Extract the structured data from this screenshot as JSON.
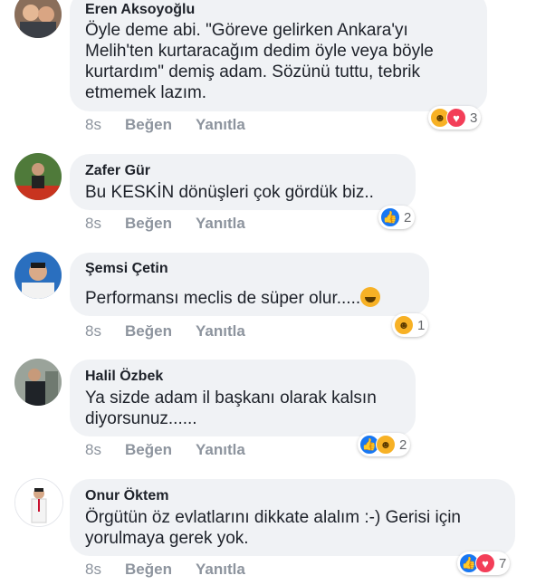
{
  "comments": [
    {
      "author": "Eren Aksoyoğlu",
      "text": "Öyle deme abi. \"Göreve gelirken Ankara'yı\nMelih'ten kurtaracağım dedim öyle veya böyle\nkurtardım\" demiş adam. Sözünü tuttu, tebrik\netmemek lazım.",
      "time": "8s",
      "like_label": "Beğen",
      "reply_label": "Yanıtla",
      "reactions": [
        "haha",
        "love"
      ],
      "reaction_count": "3"
    },
    {
      "author": "Zafer Gür",
      "text": "Bu KESKİN dönüşleri çok gördük biz..",
      "time": "8s",
      "like_label": "Beğen",
      "reply_label": "Yanıtla",
      "reactions": [
        "like"
      ],
      "reaction_count": "2"
    },
    {
      "author": "Şemsi Çetin",
      "text": "Performansı meclis de süper olur.....",
      "time": "8s",
      "like_label": "Beğen",
      "reply_label": "Yanıtla",
      "reactions": [
        "haha"
      ],
      "reaction_count": "1"
    },
    {
      "author": "Halil Özbek",
      "text": "Ya sizde adam il başkanı olarak kalsın\ndiyorsunuz......",
      "time": "8s",
      "like_label": "Beğen",
      "reply_label": "Yanıtla",
      "reactions": [
        "like",
        "haha"
      ],
      "reaction_count": "2"
    },
    {
      "author": "Onur Öktem",
      "text": "Örgütün öz evlatlarını dikkate alalım :-) Gerisi için\nyorulmaya gerek yok.",
      "time": "8s",
      "like_label": "Beğen",
      "reply_label": "Yanıtla",
      "reactions": [
        "like",
        "love"
      ],
      "reaction_count": "7"
    }
  ],
  "icons": {
    "like": "like-reaction-icon",
    "love": "love-reaction-icon",
    "haha": "haha-reaction-icon"
  },
  "colors": {
    "bubble": "#f0f2f5",
    "action_text": "#8d949e",
    "like_blue": "#1877f2",
    "love_red": "#f33e58",
    "haha_yellow": "#f7b125"
  }
}
